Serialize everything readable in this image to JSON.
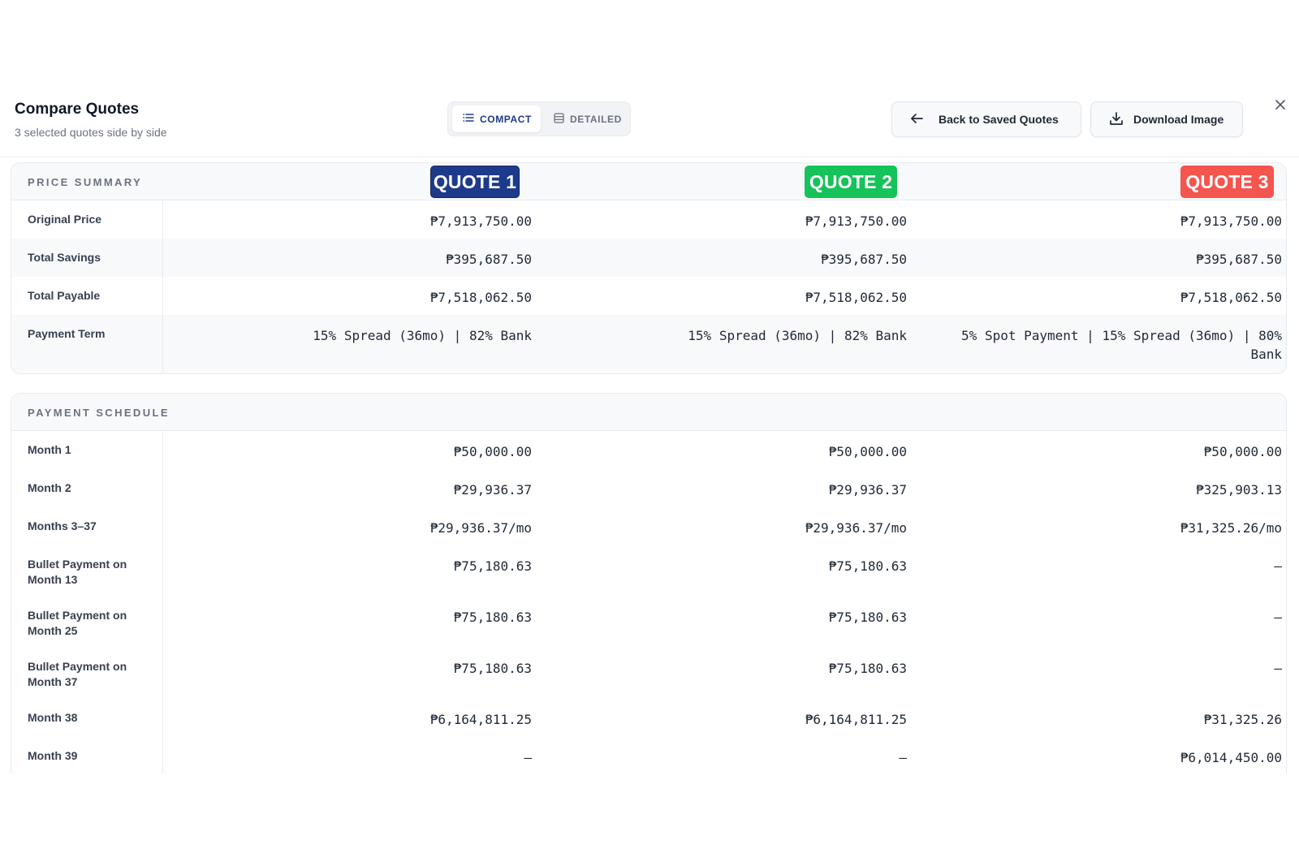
{
  "header": {
    "title": "Compare Quotes",
    "subtitle": "3 selected quotes side by side",
    "view_toggle": {
      "compact": "COMPACT",
      "detailed": "DETAILED",
      "selected": "compact"
    },
    "back_button": "Back to Saved Quotes",
    "download_button": "Download Image"
  },
  "colors": {
    "quote1": "#1e3a8a",
    "quote2": "#16c25a",
    "quote3": "#f5554f"
  },
  "quotes": [
    "QUOTE 1",
    "QUOTE 2",
    "QUOTE 3"
  ],
  "price_summary": {
    "label": "PRICE SUMMARY",
    "rows": [
      {
        "label": "Original Price",
        "values": [
          "₱7,913,750.00",
          "₱7,913,750.00",
          "₱7,913,750.00"
        ]
      },
      {
        "label": "Total Savings",
        "values": [
          "₱395,687.50",
          "₱395,687.50",
          "₱395,687.50"
        ]
      },
      {
        "label": "Total Payable",
        "values": [
          "₱7,518,062.50",
          "₱7,518,062.50",
          "₱7,518,062.50"
        ]
      },
      {
        "label": "Payment Term",
        "values": [
          "15% Spread (36mo) | 82% Bank",
          "15% Spread (36mo) | 82% Bank",
          "5% Spot Payment | 15% Spread (36mo) | 80% Bank"
        ]
      }
    ]
  },
  "payment_schedule": {
    "label": "PAYMENT SCHEDULE",
    "rows": [
      {
        "label": "Month 1",
        "values": [
          "₱50,000.00",
          "₱50,000.00",
          "₱50,000.00"
        ]
      },
      {
        "label": "Month 2",
        "values": [
          "₱29,936.37",
          "₱29,936.37",
          "₱325,903.13"
        ]
      },
      {
        "label": "Months 3–37",
        "values": [
          "₱29,936.37/mo",
          "₱29,936.37/mo",
          "₱31,325.26/mo"
        ]
      },
      {
        "label": "Bullet Payment on Month 13",
        "values": [
          "₱75,180.63",
          "₱75,180.63",
          "—"
        ]
      },
      {
        "label": "Bullet Payment on Month 25",
        "values": [
          "₱75,180.63",
          "₱75,180.63",
          "—"
        ]
      },
      {
        "label": "Bullet Payment on Month 37",
        "values": [
          "₱75,180.63",
          "₱75,180.63",
          "—"
        ]
      },
      {
        "label": "Month 38",
        "values": [
          "₱6,164,811.25",
          "₱6,164,811.25",
          "₱31,325.26"
        ]
      },
      {
        "label": "Month 39",
        "values": [
          "—",
          "—",
          "₱6,014,450.00"
        ]
      }
    ]
  }
}
